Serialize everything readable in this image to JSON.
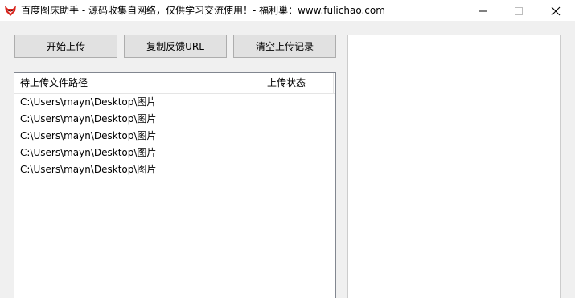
{
  "window": {
    "title": "百度图床助手 - 源码收集自网络，仅供学习交流使用！- 福利巢：www.fulichao.com",
    "app_icon": "fox-icon",
    "controls": {
      "minimize_icon": "minimize-icon",
      "maximize_icon": "maximize-icon",
      "close_icon": "close-icon"
    }
  },
  "toolbar": {
    "start_upload_label": "开始上传",
    "copy_feedback_url_label": "复制反馈URL",
    "clear_records_label": "清空上传记录"
  },
  "file_list": {
    "columns": [
      "待上传文件路径",
      "上传状态"
    ],
    "rows": [
      {
        "path": "C:\\Users\\mayn\\Desktop\\图片",
        "status": ""
      },
      {
        "path": "C:\\Users\\mayn\\Desktop\\图片",
        "status": ""
      },
      {
        "path": "C:\\Users\\mayn\\Desktop\\图片",
        "status": ""
      },
      {
        "path": "C:\\Users\\mayn\\Desktop\\图片",
        "status": ""
      },
      {
        "path": "C:\\Users\\mayn\\Desktop\\图片",
        "status": ""
      }
    ]
  },
  "output_panel": {
    "text": ""
  },
  "colors": {
    "window_bg": "#f0f0f0",
    "button_bg": "#e1e1e1",
    "button_border": "#adadad",
    "icon_red": "#d9241c"
  }
}
